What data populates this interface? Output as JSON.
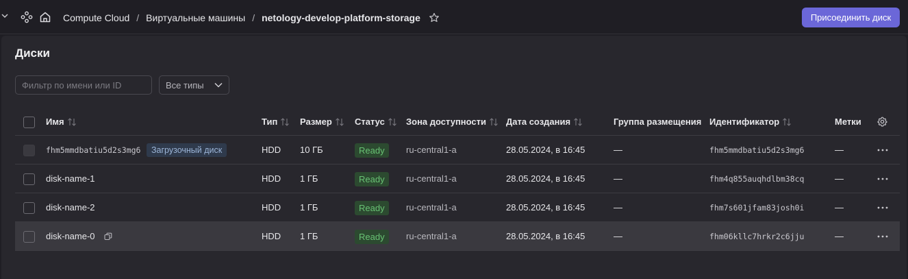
{
  "header": {
    "breadcrumb": [
      "Compute Cloud",
      "Виртуальные машины",
      "netology-develop-platform-storage"
    ],
    "attach_button": "Присоединить диск"
  },
  "page": {
    "title": "Диски",
    "filter_placeholder": "Фильтр по имени или ID",
    "type_select": "Все типы"
  },
  "table": {
    "columns": {
      "name": "Имя",
      "type": "Тип",
      "size": "Размер",
      "status": "Статус",
      "zone": "Зона доступности",
      "created": "Дата создания",
      "placement": "Группа размещения",
      "id": "Идентификатор",
      "labels": "Метки"
    },
    "rows": [
      {
        "name": "fhm5mmdbatiu5d2s3mg6",
        "badge": "Загрузочный диск",
        "type": "HDD",
        "size": "10 ГБ",
        "status": "Ready",
        "zone": "ru-central1-a",
        "created": "28.05.2024, в 16:45",
        "placement": "—",
        "id": "fhm5mmdbatiu5d2s3mg6",
        "labels": "—"
      },
      {
        "name": "disk-name-1",
        "type": "HDD",
        "size": "1 ГБ",
        "status": "Ready",
        "zone": "ru-central1-a",
        "created": "28.05.2024, в 16:45",
        "placement": "—",
        "id": "fhm4q855auqhdlbm38cq",
        "labels": "—"
      },
      {
        "name": "disk-name-2",
        "type": "HDD",
        "size": "1 ГБ",
        "status": "Ready",
        "zone": "ru-central1-a",
        "created": "28.05.2024, в 16:45",
        "placement": "—",
        "id": "fhm7s601jfam83josh0i",
        "labels": "—"
      },
      {
        "name": "disk-name-0",
        "type": "HDD",
        "size": "1 ГБ",
        "status": "Ready",
        "zone": "ru-central1-a",
        "created": "28.05.2024, в 16:45",
        "placement": "—",
        "id": "fhm06kllc7hrkr2c6jju",
        "labels": "—"
      }
    ]
  },
  "colors": {
    "accent": "#6b67d8",
    "status_ready_bg": "#2c4a30",
    "status_ready_text": "#69c274",
    "boot_badge_bg": "#2f3a4c"
  },
  "icons": [
    "chevron-down-icon",
    "nodes-icon",
    "home-icon",
    "star-icon",
    "sort-icon",
    "gear-icon",
    "more-icon",
    "copy-icon"
  ]
}
